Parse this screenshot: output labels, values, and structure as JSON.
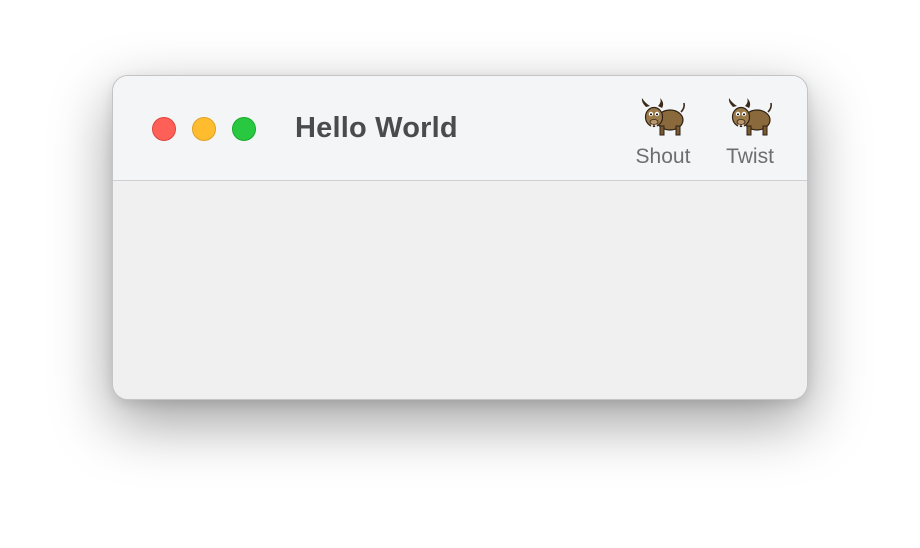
{
  "window": {
    "title": "Hello World"
  },
  "traffic_lights": {
    "close_color": "#fe5f57",
    "minimize_color": "#febc2e",
    "zoom_color": "#28c840"
  },
  "toolbar": {
    "items": [
      {
        "label": "Shout",
        "icon": "yak-icon"
      },
      {
        "label": "Twist",
        "icon": "yak-icon"
      }
    ]
  }
}
